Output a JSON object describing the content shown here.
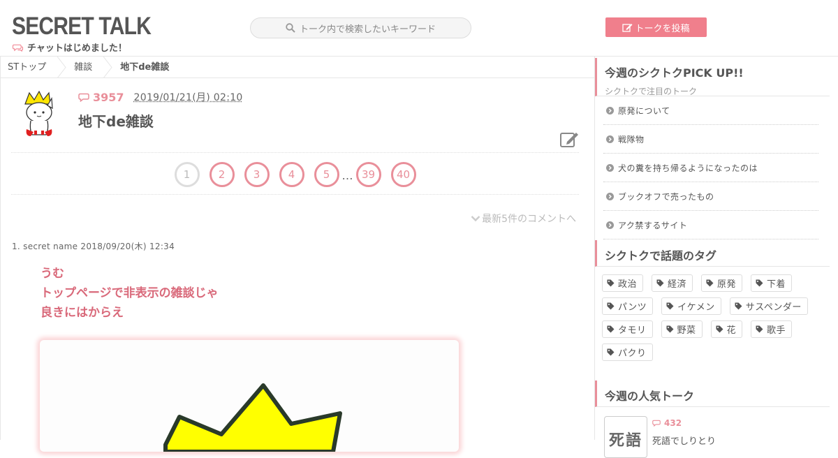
{
  "header": {
    "logo": "SECRET TALK",
    "tagline": "チャットはじめました！",
    "search_placeholder": "トーク内で検索したいキーワード",
    "post_button": "トークを投稿"
  },
  "breadcrumb": [
    "STトップ",
    "雑談",
    "地下de雑談"
  ],
  "post": {
    "comment_count": "3957",
    "date": "2019/01/21(月) 02:10",
    "title": "地下de雑談"
  },
  "pager": {
    "current": "1",
    "pages": [
      "2",
      "3",
      "4",
      "5"
    ],
    "ellipsis": "…",
    "tail": [
      "39",
      "40"
    ]
  },
  "latest_link": "最新5件のコメントへ",
  "comment": {
    "meta": "1. secret name 2018/09/20(木) 12:34",
    "lines": [
      "うむ",
      "トップページで非表示の雑談じゃ",
      "良きにはからえ"
    ]
  },
  "sidebar": {
    "pickup": {
      "title": "今週のシクトクPICK UP!!",
      "subtitle": "シクトクで注目のトーク",
      "items": [
        "原発について",
        "戦隊物",
        "犬の糞を持ち帰るようになったのは",
        "ブックオフで売ったもの",
        "アク禁するサイト"
      ]
    },
    "tags": {
      "title": "シクトクで話題のタグ",
      "items": [
        "政治",
        "経済",
        "原発",
        "下着",
        "パンツ",
        "イケメン",
        "サスペンダー",
        "タモリ",
        "野菜",
        "花",
        "歌手",
        "パクり"
      ]
    },
    "popular": {
      "title": "今週の人気トーク",
      "count": "432",
      "thumb_text": "死語",
      "item_title": "死語でしりとり"
    }
  },
  "colors": {
    "accent": "#f07f8c",
    "pink_text": "#d9697a",
    "text": "#555555"
  }
}
